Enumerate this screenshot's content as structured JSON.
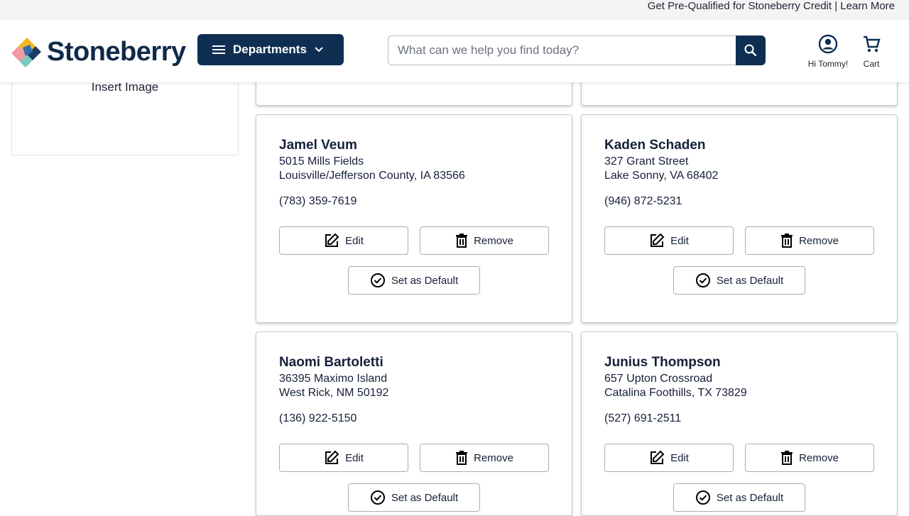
{
  "promo": {
    "text": "Get Pre-Qualified for Stoneberry Credit | Learn More"
  },
  "header": {
    "brand": "Stoneberry",
    "departments_label": "Departments",
    "search_placeholder": "What can we help you find today?",
    "account_label": "Hi Tommy!",
    "cart_label": "Cart"
  },
  "sidebar": {
    "insert_image": "Insert Image"
  },
  "buttons": {
    "edit": "Edit",
    "remove": "Remove",
    "set_default": "Set as Default"
  },
  "addresses": [
    {
      "name": "Jamel Veum",
      "street": "5015 Mills Fields",
      "city": "Louisville/Jefferson County, IA 83566",
      "phone": "(783) 359-7619"
    },
    {
      "name": "Kaden Schaden",
      "street": "327 Grant Street",
      "city": "Lake Sonny, VA 68402",
      "phone": "(946) 872-5231"
    },
    {
      "name": "Naomi Bartoletti",
      "street": "36395 Maximo Island",
      "city": "West Rick, NM 50192",
      "phone": "(136) 922-5150"
    },
    {
      "name": "Junius Thompson",
      "street": "657 Upton Crossroad",
      "city": "Catalina Foothills, TX 73829",
      "phone": "(527) 691-2511"
    }
  ],
  "colors": {
    "brand_navy": "#0f2f52",
    "text": "#15203a",
    "promo_bg": "#f4f4f4"
  },
  "icons": [
    "menu-icon",
    "chevron-down-icon",
    "search-icon",
    "account-icon",
    "cart-icon",
    "edit-icon",
    "trash-icon",
    "check-circle-icon"
  ]
}
